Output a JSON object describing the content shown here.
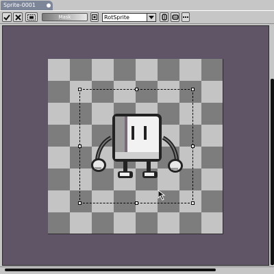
{
  "window": {
    "tab_title": "Sprite-0001"
  },
  "toolbar": {
    "mask_label": "Mask",
    "rotation_algorithm": "RotSprite"
  },
  "icons": {
    "confirm": "checkmark-icon",
    "cancel": "x-icon",
    "selection": "selection-frame-icon",
    "pivot": "pivot-icon",
    "dropdown": "chevron-down-icon",
    "flip_h": "flip-horizontal-icon",
    "flip_v": "flip-vertical-icon",
    "more": "more-icon"
  },
  "colors": {
    "tab_active": "#7d8599",
    "editor_background": "#5f5566",
    "checker_light": "#c4c4c4",
    "checker_dark": "#7d7d7d"
  }
}
